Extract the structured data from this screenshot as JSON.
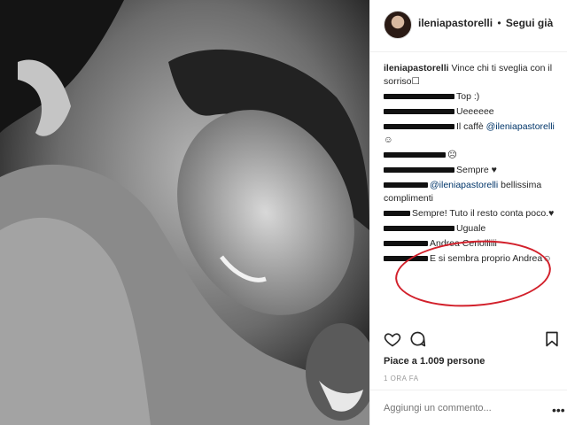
{
  "header": {
    "username": "ileniapastorelli",
    "separator": "•",
    "follow_label": "Segui già"
  },
  "caption": {
    "username": "ileniapastorelli",
    "text": "Vince chi ti sveglia con il sorriso☐"
  },
  "comments": [
    {
      "redact": 80,
      "text": "Top :)"
    },
    {
      "redact": 80,
      "text": "Ueeeeee"
    },
    {
      "redact": 80,
      "text": "Il caffè ",
      "mention": "@ileniapastorelli",
      "after": " ☺"
    },
    {
      "redact": 70,
      "text": "☹"
    },
    {
      "redact": 80,
      "text": "Sempre ♥"
    },
    {
      "redact": 50,
      "text": "",
      "mention": "@ileniapastorelli",
      "after": " bellissima complimenti"
    },
    {
      "redact": 30,
      "text": "Sempre! Tuto il resto conta poco.♥"
    },
    {
      "redact": 80,
      "text": "Uguale"
    },
    {
      "redact": 50,
      "text": "Andrea Ceriolliiii"
    },
    {
      "redact": 50,
      "text": "E si sembra proprio Andrea☺"
    }
  ],
  "icons": {
    "like": "heart-icon",
    "comment": "comment-icon",
    "save": "bookmark-icon",
    "more": "more-icon"
  },
  "likes_text": "Piace a 1.009 persone",
  "time_text": "1 ORA FA",
  "add_comment_placeholder": "Aggiungi un commento...",
  "more_glyph": "•••",
  "colors": {
    "highlight_circle": "#d2202b",
    "mention": "#003569"
  }
}
